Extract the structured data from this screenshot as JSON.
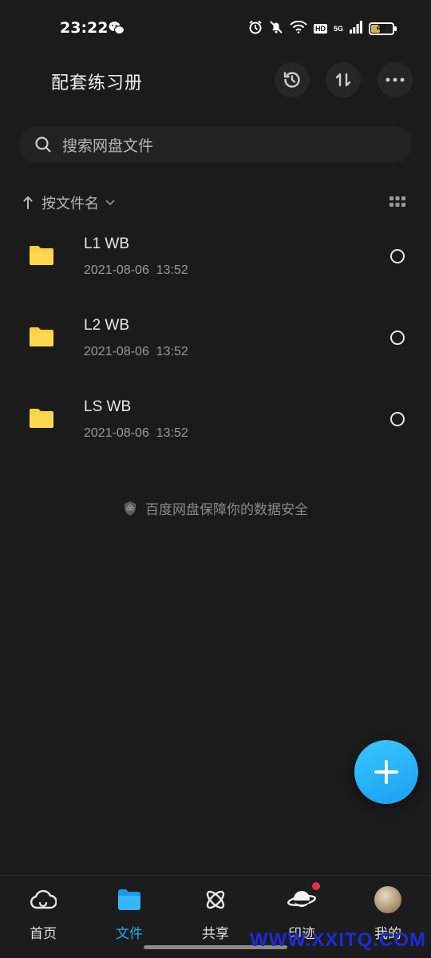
{
  "status_bar": {
    "time": "23:22",
    "network": "5G",
    "hd": "HD",
    "battery": "43",
    "battery_level": 0.43
  },
  "header": {
    "title": "配套练习册",
    "icons": [
      "history-icon",
      "transfer-icon",
      "more-icon"
    ]
  },
  "search": {
    "placeholder": "搜索网盘文件"
  },
  "sort": {
    "label": "按文件名"
  },
  "files": [
    {
      "name": "L1 WB",
      "date": "2021-08-06  13:52"
    },
    {
      "name": "L2 WB",
      "date": "2021-08-06  13:52"
    },
    {
      "name": "LS WB",
      "date": "2021-08-06  13:52"
    }
  ],
  "safety_note": "百度网盘保障你的数据安全",
  "tabs": [
    {
      "label": "首页",
      "active": false
    },
    {
      "label": "文件",
      "active": true
    },
    {
      "label": "共享",
      "active": false
    },
    {
      "label": "印迹",
      "active": false
    },
    {
      "label": "我的",
      "active": false
    }
  ],
  "watermark": "WWW.XXITQ.COM",
  "colors": {
    "background": "#1b1b1c",
    "accent": "#26a6f3",
    "folder": "#ffcf3d",
    "badge_red": "#e8304e"
  }
}
